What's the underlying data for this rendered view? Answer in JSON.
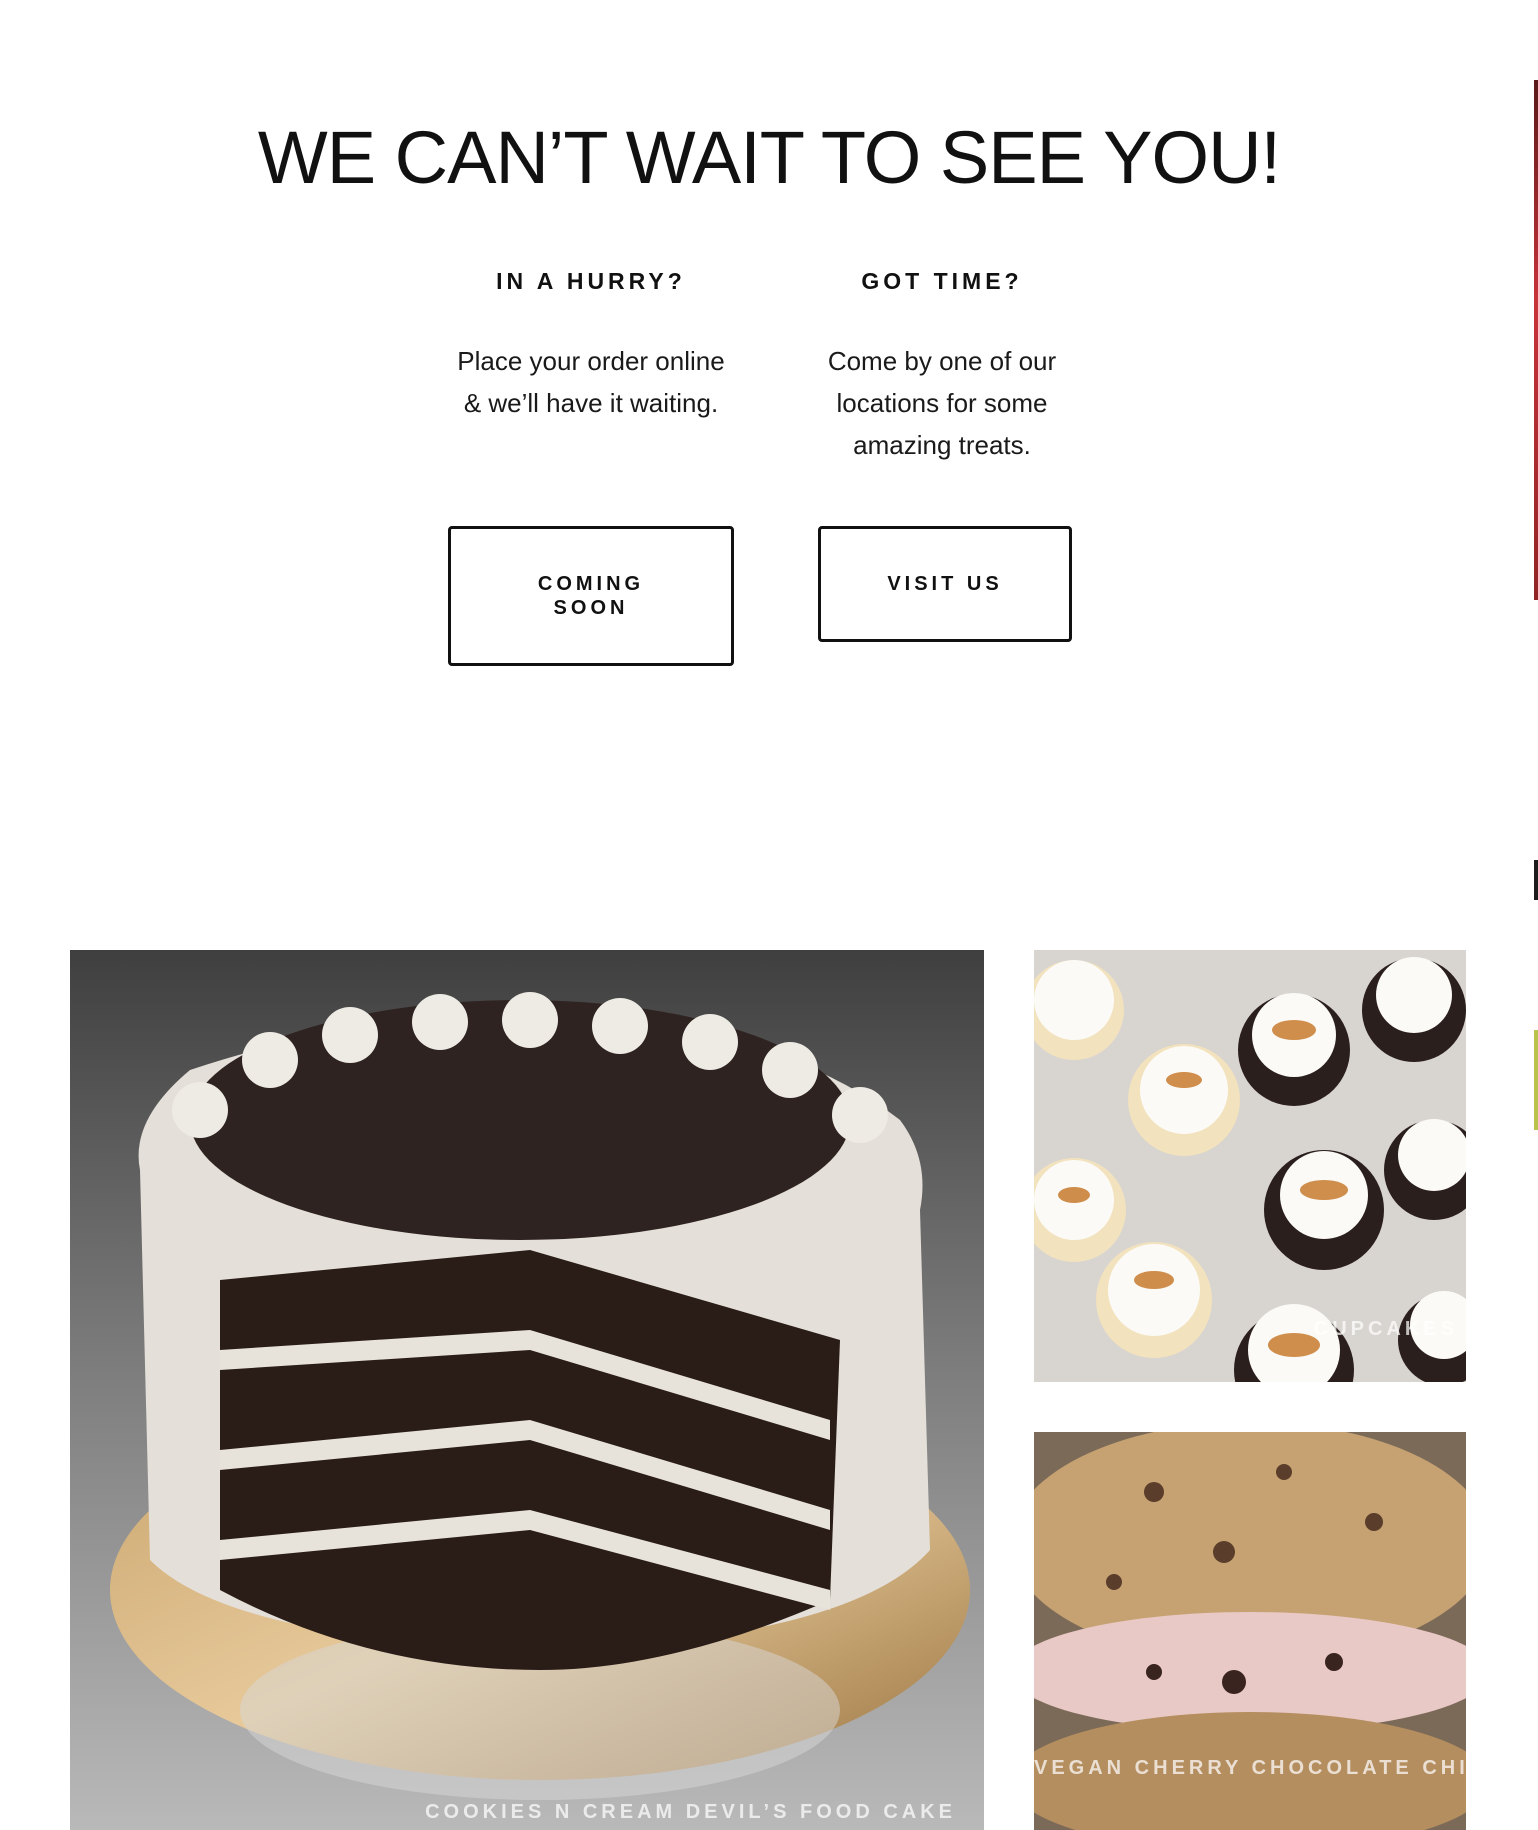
{
  "headline": "WE CAN’T WAIT TO SEE YOU!",
  "columns": [
    {
      "heading": "IN A HURRY?",
      "body": "Place your order online & we’ll have it waiting.",
      "button_label": "COMING SOON"
    },
    {
      "heading": "GOT TIME?",
      "body": "Come by one of our locations for some amazing treats.",
      "button_label": "VISIT US"
    }
  ],
  "gallery": [
    {
      "caption": "COOKIES N CREAM DEVIL’S FOOD CAKE"
    },
    {
      "caption": "CUPCAKES"
    },
    {
      "caption": "VEGAN CHERRY CHOCOLATE CHIP COOKIEWICH"
    }
  ]
}
